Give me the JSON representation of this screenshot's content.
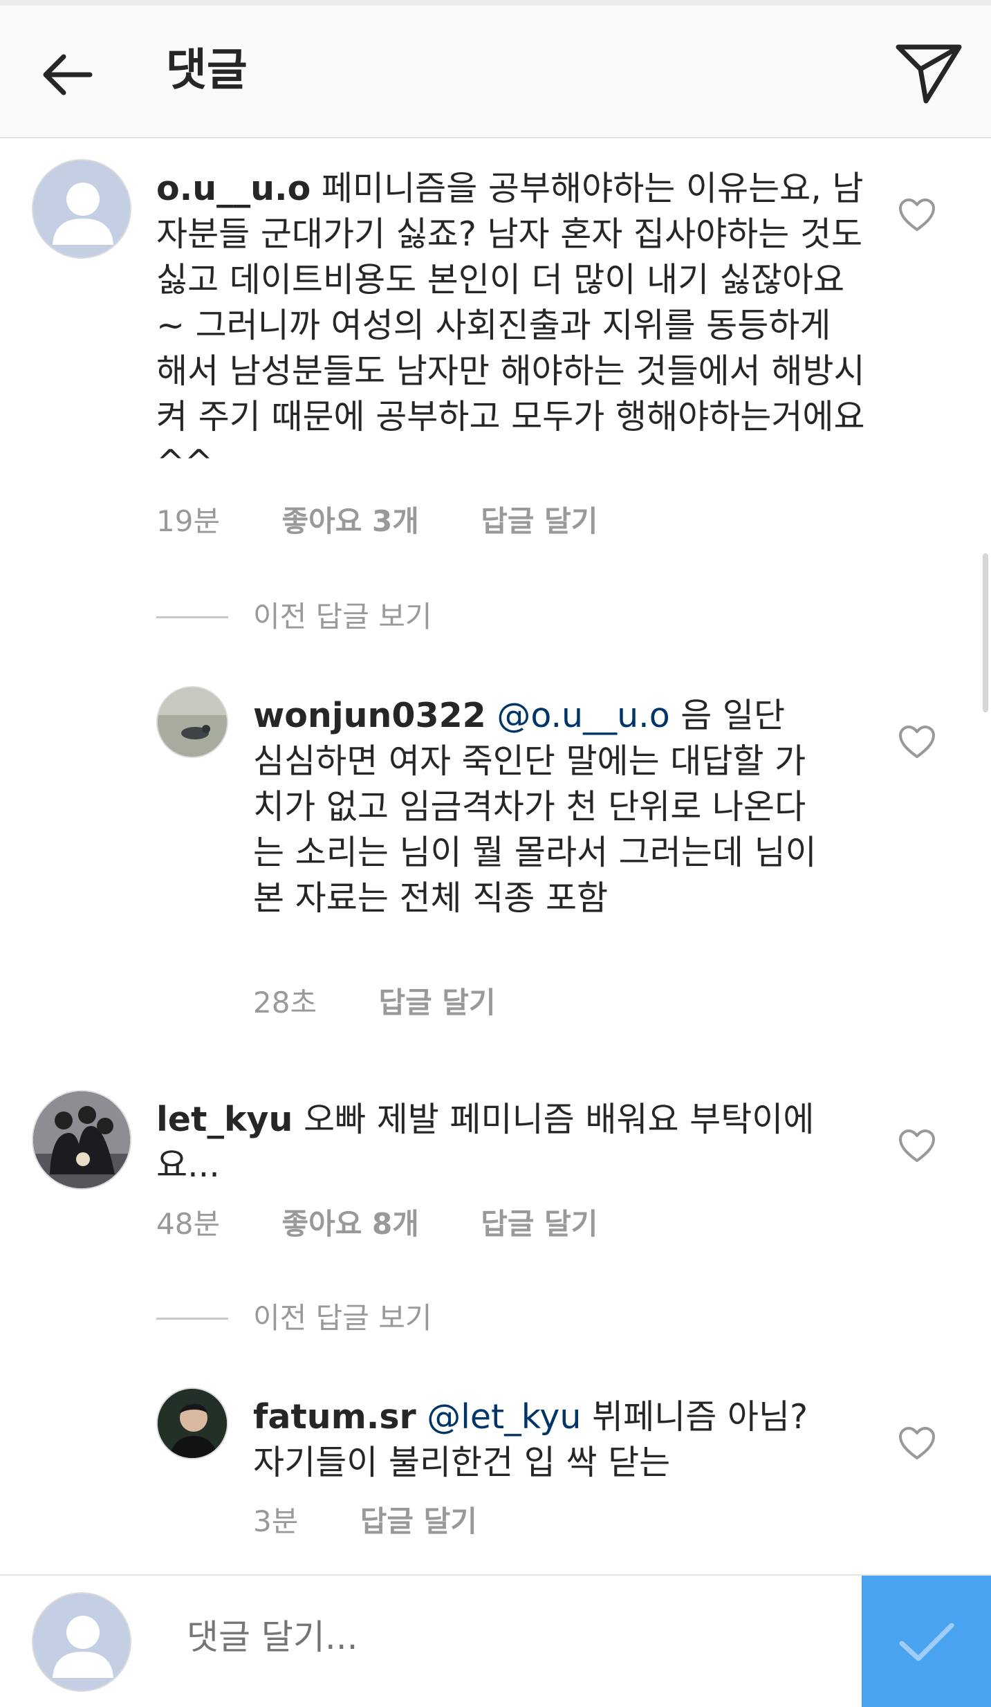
{
  "header": {
    "title": "댓글",
    "back_icon": "arrow-left-icon",
    "send_icon": "paper-plane-icon"
  },
  "comments": [
    {
      "username": "o.u__u.o",
      "text": "페미니즘을 공부해야하는 이유는요, 남자분들 군대가기 싫죠? 남자 혼자 집사야하는 것도 싫고 데이트비용도 본인이 더 많이 내기 싫잖아요~ 그러니까 여성의 사회진출과 지위를 동등하게 해서 남성분들도 남자만 해야하는 것들에서 해방시켜 주기 때문에 공부하고 모두가 행해야하는거에요^^",
      "time": "19분",
      "likes": "좋아요 3개",
      "reply": "답글 달기",
      "view_replies": "이전 답글 보기",
      "replies": [
        {
          "username": "wonjun0322",
          "mention": "@o.u__u.o",
          "text": "음 일단 심심하면 여자 죽인단 말에는 대답할 가치가 없고 임금격차가 천 단위로 나온다는 소리는 님이 뭘 몰라서 그러는데 님이 본 자료는 전체 직종 포함",
          "time": "28초",
          "reply": "답글 달기"
        }
      ]
    },
    {
      "username": "let_kyu",
      "text": "오빠 제발 페미니즘 배워요 부탁이에요...",
      "time": "48분",
      "likes": "좋아요 8개",
      "reply": "답글 달기",
      "view_replies": "이전 답글 보기",
      "replies": [
        {
          "username": "fatum.sr",
          "mention": "@let_kyu",
          "text": "뷔페니즘 아님? 자기들이 불리한건 입 싹 닫는",
          "time": "3분",
          "reply": "답글 달기"
        }
      ]
    }
  ],
  "footer": {
    "placeholder": "댓글 달기...",
    "post_icon": "checkmark-icon"
  },
  "colors": {
    "header_bg": "#fafafa",
    "text": "#262626",
    "meta": "#999999",
    "mention": "#003569",
    "post_button": "#4aa3f0"
  }
}
